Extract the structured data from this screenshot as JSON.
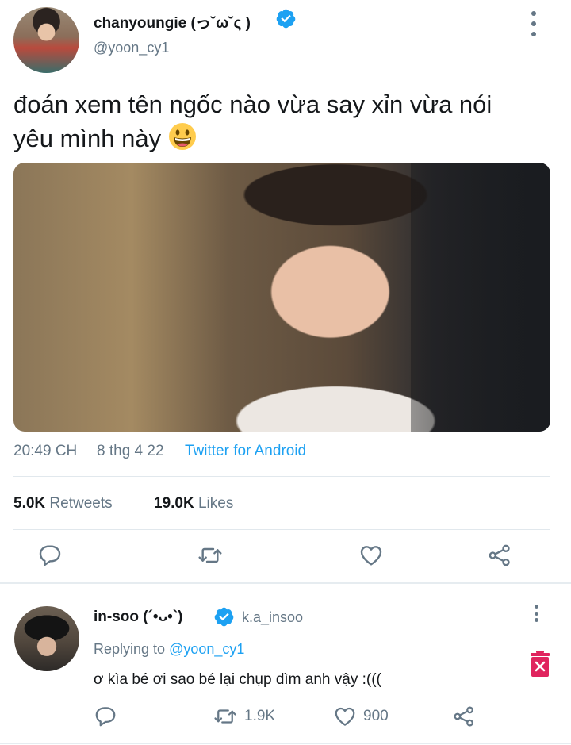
{
  "tweet": {
    "display_name": "chanyoungie (ɔˆ ³(ˆ⌣ˆc)",
    "display_name_shown": "chanyoungie (っ˘ω˘ς )",
    "handle": "@yoon_cy1",
    "text_line1": "đoán xem tên ngốc nào vừa say xỉn vừa nói",
    "text_line2": "yêu mình này",
    "time": "20:49 CH",
    "date": "8 thg 4 22",
    "source": "Twitter for Android",
    "retweets_count": "5.0K",
    "retweets_label": "Retweets",
    "likes_count": "19.0K",
    "likes_label": "Likes"
  },
  "reply": {
    "display_name": "in-soo (´•ᴗ•`)",
    "handle": "k.a_insoo",
    "replying_prefix": "Replying to",
    "replying_to": "@yoon_cy1",
    "text": "ơ kìa bé ơi sao bé lại chụp dìm anh vậy :(((",
    "retweet_count": "1.9K",
    "like_count": "900"
  },
  "icons": {
    "verified": "verified-badge-icon",
    "more": "more-vertical-icon",
    "reply": "reply-icon",
    "retweet": "retweet-icon",
    "like": "heart-icon",
    "share": "share-icon",
    "delete": "delete-icon"
  },
  "colors": {
    "accent": "#1da1f2",
    "muted": "#657786",
    "delete": "#e0245e"
  }
}
